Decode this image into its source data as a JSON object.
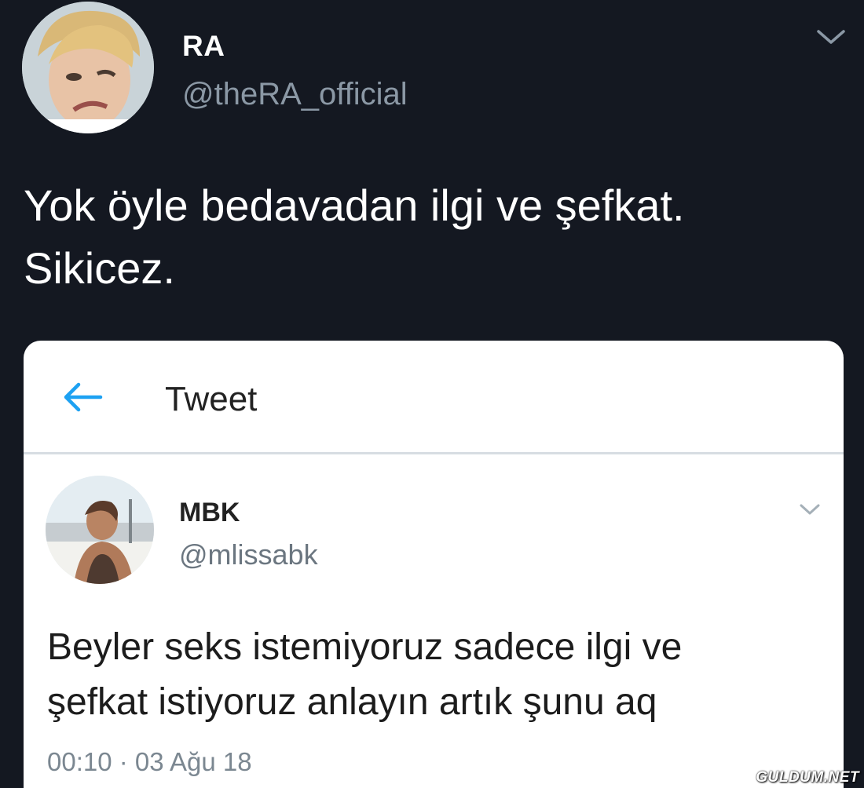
{
  "outer_tweet": {
    "display_name": "RA",
    "handle": "@theRA_official",
    "text_line1": "Yok öyle bedavadan ilgi ve şefkat.",
    "text_line2": "Sikicez.",
    "avatar_icon": "child-avatar",
    "menu_icon": "chevron-down-icon"
  },
  "quoted_screenshot": {
    "header_title": "Tweet",
    "back_icon": "back-arrow-icon",
    "accent_color": "#1da1f2",
    "author": {
      "display_name": "MBK",
      "handle": "@mlissabk",
      "avatar_icon": "user-avatar"
    },
    "text_line1": "Beyler seks istemiyoruz sadece ilgi ve",
    "text_line2": "şefkat istiyoruz anlayın artık şunu aq",
    "timestamp": "00:10 · 03 Ağu 18"
  },
  "watermark": "GULDUM.NET"
}
